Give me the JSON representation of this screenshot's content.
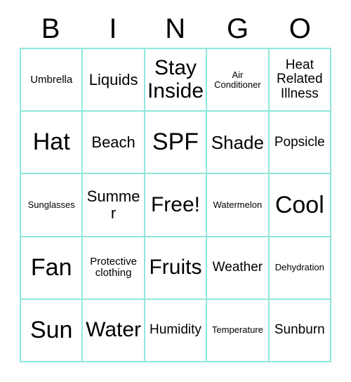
{
  "card": {
    "header_letters": [
      "B",
      "I",
      "N",
      "G",
      "O"
    ],
    "border_color": "#8fe8dc",
    "text_color": "#000000",
    "background_color": "#ffffff",
    "rows": [
      [
        {
          "label": "Umbrella",
          "size": "sm"
        },
        {
          "label": "Liquids",
          "size": "lg"
        },
        {
          "label": "Stay Inside",
          "size": "xxl"
        },
        {
          "label": "Air Conditioner",
          "size": "xs"
        },
        {
          "label": "Heat Related Illness",
          "size": "md"
        }
      ],
      [
        {
          "label": "Hat",
          "size": "huge"
        },
        {
          "label": "Beach",
          "size": "lg"
        },
        {
          "label": "SPF",
          "size": "huge"
        },
        {
          "label": "Shade",
          "size": "xl"
        },
        {
          "label": "Popsicle",
          "size": "md"
        }
      ],
      [
        {
          "label": "Sunglasses",
          "size": "xs"
        },
        {
          "label": "Summer",
          "size": "lg"
        },
        {
          "label": "Free!",
          "size": "xxl"
        },
        {
          "label": "Watermelon",
          "size": "xs"
        },
        {
          "label": "Cool",
          "size": "huge"
        }
      ],
      [
        {
          "label": "Fan",
          "size": "huge"
        },
        {
          "label": "Protective clothing",
          "size": "sm"
        },
        {
          "label": "Fruits",
          "size": "xxl"
        },
        {
          "label": "Weather",
          "size": "md"
        },
        {
          "label": "Dehydration",
          "size": "xs"
        }
      ],
      [
        {
          "label": "Sun",
          "size": "huge"
        },
        {
          "label": "Water",
          "size": "xxl"
        },
        {
          "label": "Humidity",
          "size": "md"
        },
        {
          "label": "Temperature",
          "size": "xs"
        },
        {
          "label": "Sunburn",
          "size": "md"
        }
      ]
    ]
  }
}
